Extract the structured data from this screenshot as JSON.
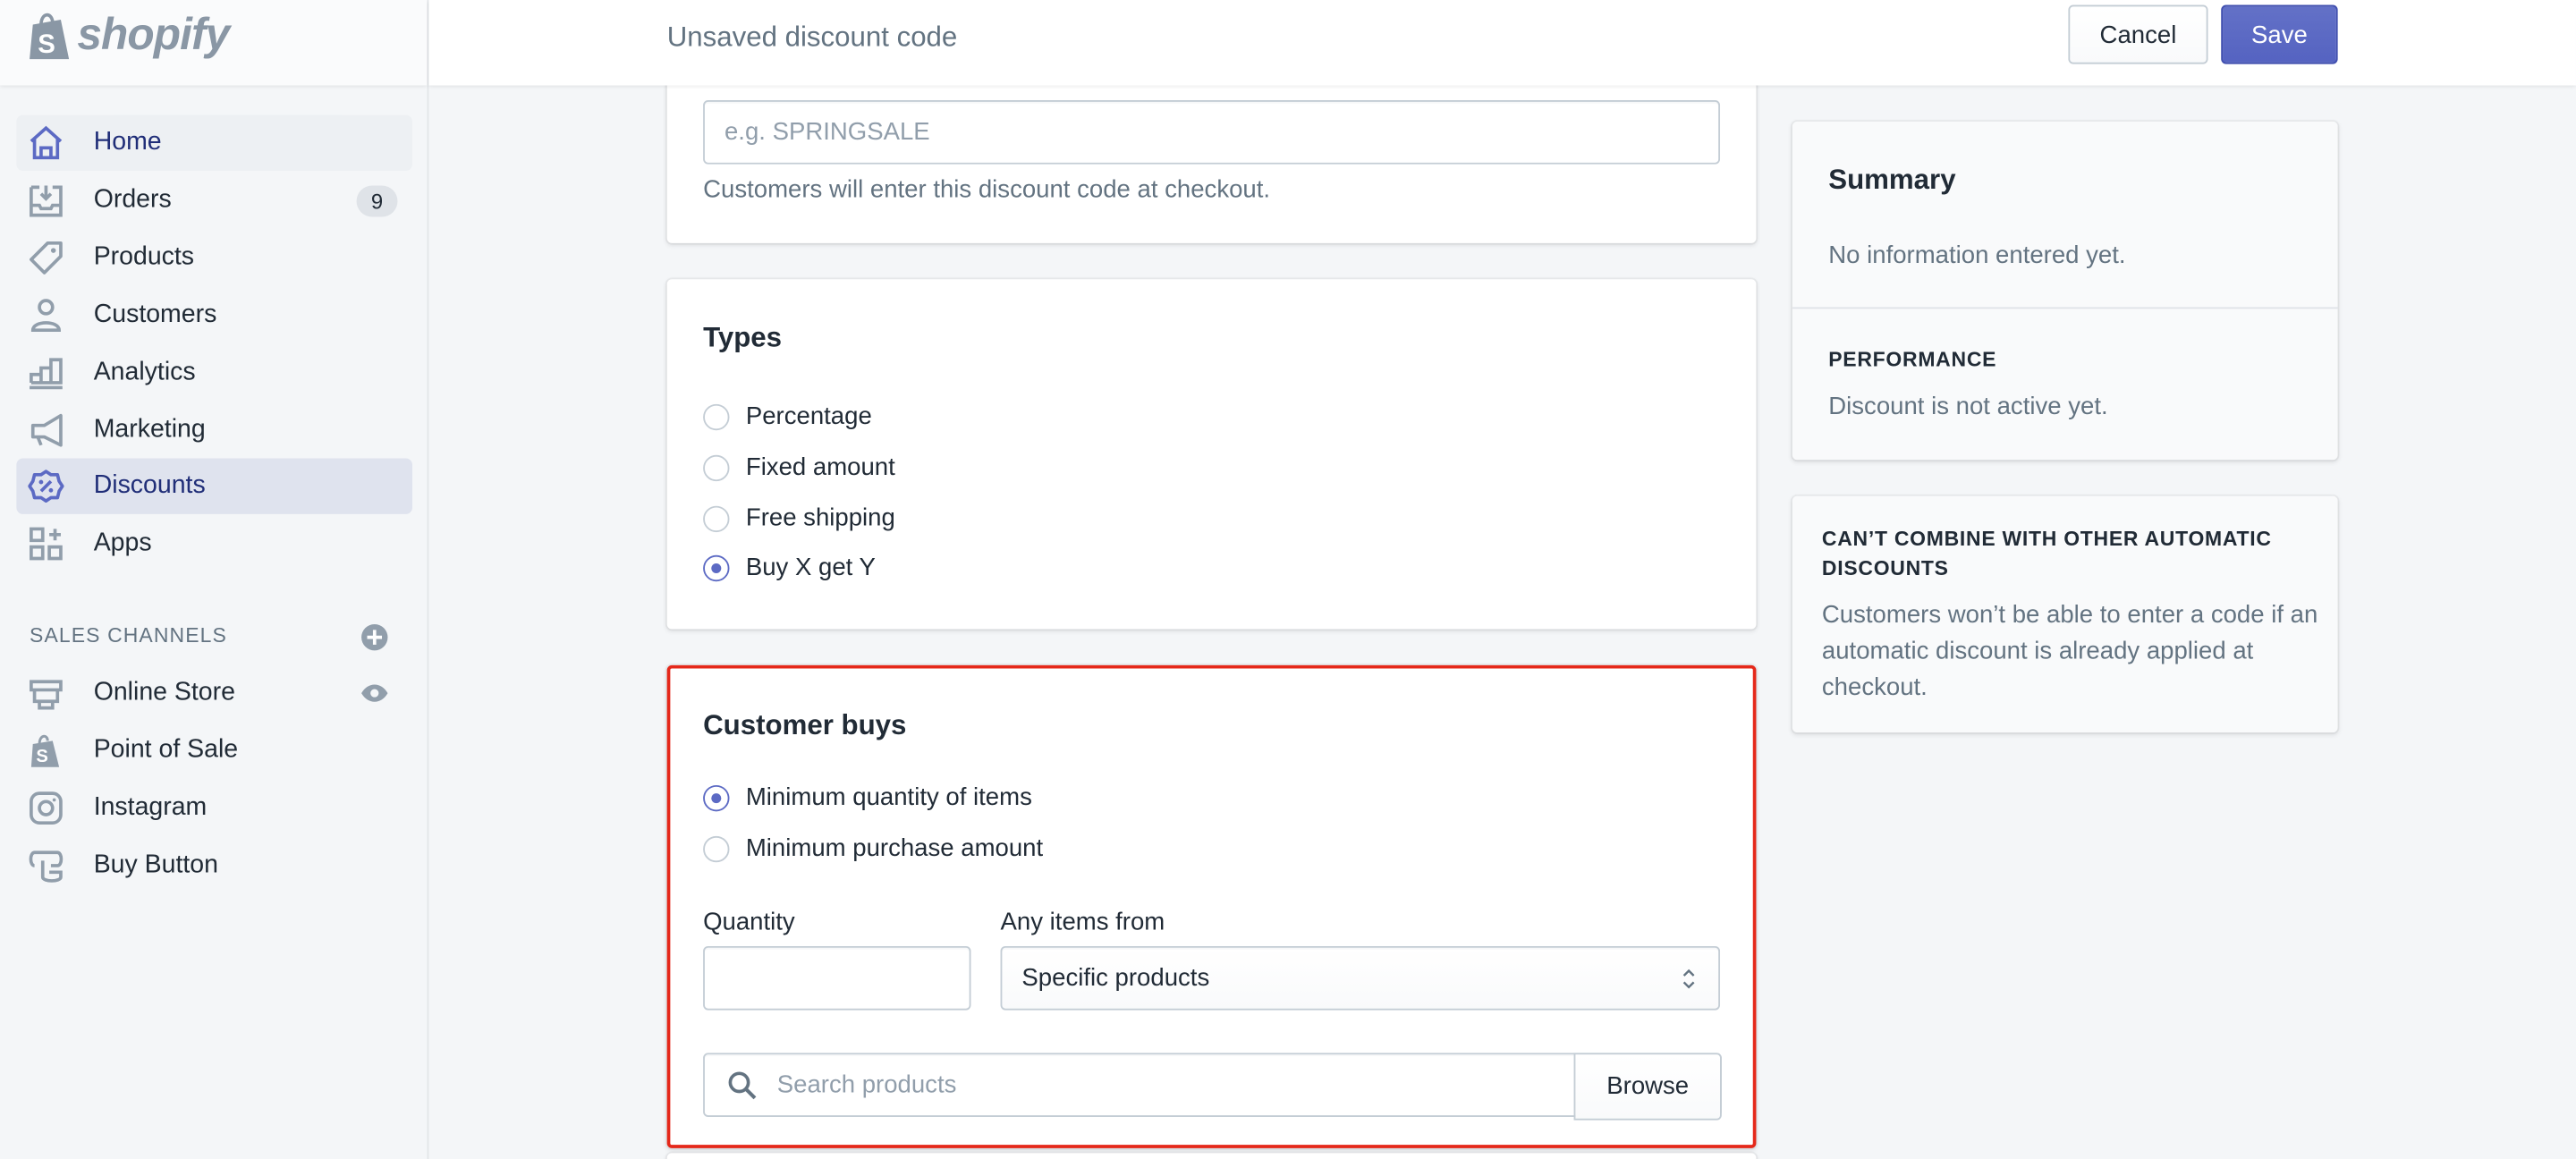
{
  "brand": {
    "name": "shopify"
  },
  "sidebar": {
    "items": [
      {
        "label": "Home",
        "icon": "home-icon"
      },
      {
        "label": "Orders",
        "icon": "orders-icon",
        "badge": "9"
      },
      {
        "label": "Products",
        "icon": "tag-icon"
      },
      {
        "label": "Customers",
        "icon": "person-icon"
      },
      {
        "label": "Analytics",
        "icon": "bar-chart-icon"
      },
      {
        "label": "Marketing",
        "icon": "megaphone-icon"
      },
      {
        "label": "Discounts",
        "icon": "discount-icon"
      },
      {
        "label": "Apps",
        "icon": "apps-icon"
      }
    ],
    "sales_channels_label": "SALES CHANNELS",
    "channels": [
      {
        "label": "Online Store",
        "icon": "store-icon"
      },
      {
        "label": "Point of Sale",
        "icon": "shopify-bag-icon"
      },
      {
        "label": "Instagram",
        "icon": "instagram-icon"
      },
      {
        "label": "Buy Button",
        "icon": "buy-button-icon"
      }
    ]
  },
  "header": {
    "title": "Unsaved discount code",
    "cancel": "Cancel",
    "save": "Save"
  },
  "code_card": {
    "placeholder": "e.g. SPRINGSALE",
    "help": "Customers will enter this discount code at checkout."
  },
  "types": {
    "title": "Types",
    "options": [
      "Percentage",
      "Fixed amount",
      "Free shipping",
      "Buy X get Y"
    ],
    "selected": "Buy X get Y"
  },
  "customer_buys": {
    "title": "Customer buys",
    "options": [
      "Minimum quantity of items",
      "Minimum purchase amount"
    ],
    "selected": "Minimum quantity of items",
    "quantity_label": "Quantity",
    "quantity_value": "",
    "items_from_label": "Any items from",
    "items_from_value": "Specific products",
    "search_placeholder": "Search products",
    "browse": "Browse",
    "highlight_color": "#e5281a"
  },
  "summary": {
    "title": "Summary",
    "empty": "No information entered yet.",
    "performance_label": "PERFORMANCE",
    "performance_text": "Discount is not active yet."
  },
  "combine": {
    "title": "CAN’T COMBINE WITH OTHER AUTOMATIC DISCOUNTS",
    "text": "Customers won’t be able to enter a code if an automatic discount is already applied at checkout."
  },
  "colors": {
    "primary": "#5c6ac4",
    "text": "#212b36",
    "subdued": "#637381",
    "background": "#f4f6f8"
  }
}
